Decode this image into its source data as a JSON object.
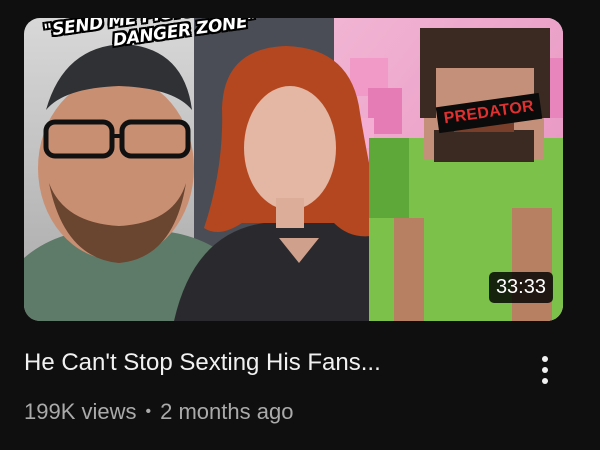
{
  "video": {
    "thumbnail": {
      "caption_lines": [
        "\"SEND ME PICTURES OF YOUR",
        "DANGER ZONE\""
      ],
      "label": "PREDATOR",
      "duration": "33:33"
    },
    "title": "He Can't Stop Sexting His Fans...",
    "views": "199K views",
    "separator": "•",
    "age": "2 months ago",
    "menu_icon": "more-vert-icon"
  }
}
